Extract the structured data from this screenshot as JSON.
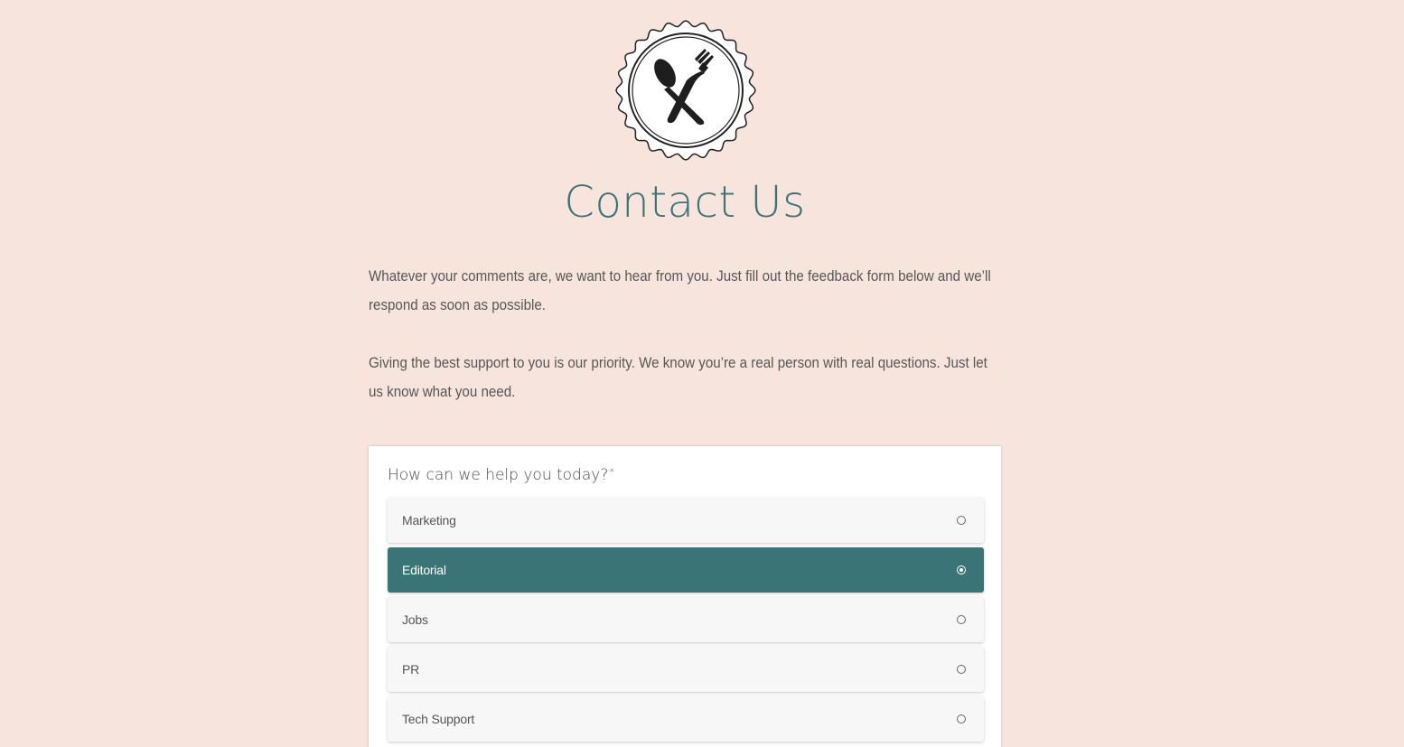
{
  "page": {
    "title": "Contact Us",
    "logo_icon": "spoon-fork-badge-icon",
    "accent_color": "#3b7476",
    "background_color": "#f7e4dd"
  },
  "intro": {
    "paragraph_1": "Whatever your comments are, we want to hear from you. Just fill out the feedback form below and we’ll respond as soon as possible.",
    "paragraph_2": "Giving the best support to you is our priority. We know you’re a real person with real questions. Just let us know what you need."
  },
  "form": {
    "question": "How can we help you today?",
    "required_mark": "*",
    "options": [
      {
        "label": "Marketing",
        "selected": false
      },
      {
        "label": "Editorial",
        "selected": true
      },
      {
        "label": "Jobs",
        "selected": false
      },
      {
        "label": "PR",
        "selected": false
      },
      {
        "label": "Tech Support",
        "selected": false
      }
    ]
  }
}
